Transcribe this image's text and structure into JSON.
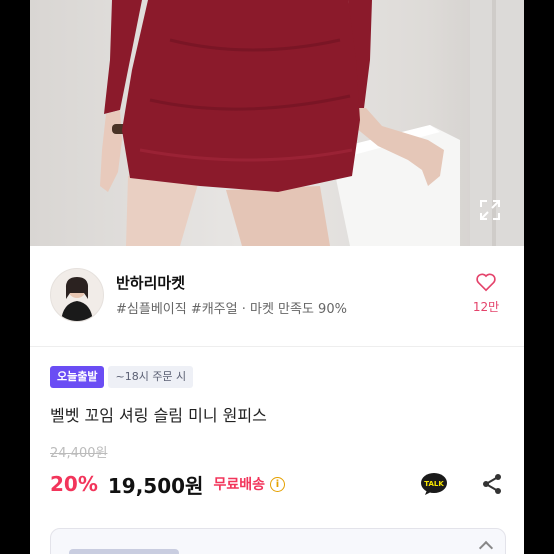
{
  "seller": {
    "name": "반하리마켓",
    "tags": "#심플베이직 #캐주얼 · 마켓 만족도 90%",
    "like_count": "12만"
  },
  "delivery": {
    "badge": "오늘출발",
    "cutoff": "~18시 주문 시"
  },
  "product": {
    "title": "벨벳 꼬임 셔링 슬림 미니 원피스",
    "original_price": "24,400원",
    "discount": "20%",
    "price": "19,500원",
    "shipping": "무료배송"
  },
  "colors": {
    "accent": "#f2355b",
    "badge": "#6a4df4",
    "dress": "#8b1a2b"
  },
  "icons": [
    "expand-icon",
    "heart-icon",
    "info-icon",
    "kakao-talk-icon",
    "share-icon",
    "chevron-up-icon"
  ]
}
